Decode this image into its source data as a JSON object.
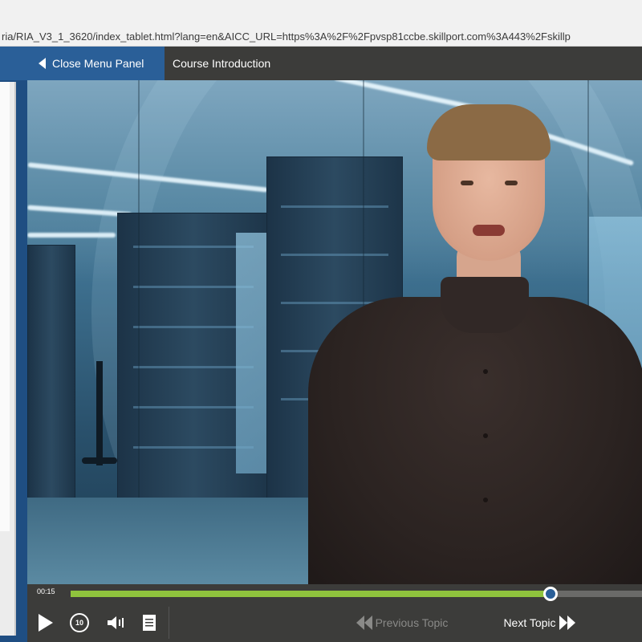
{
  "browser": {
    "url": "ria/RIA_V3_1_3620/index_tablet.html?lang=en&AICC_URL=https%3A%2F%2Fpvsp81ccbe.skillport.com%3A443%2Fskillp"
  },
  "header": {
    "close_menu_label": "Close Menu Panel",
    "course_title": "Course Introduction"
  },
  "player": {
    "current_time": "00:15",
    "progress": 0.84,
    "replay_label": "10",
    "previous_label": "Previous Topic",
    "next_label": "Next Topic"
  },
  "icons": {
    "close": "chevron-left-icon",
    "play": "play-icon",
    "replay": "replay-10-icon",
    "volume": "volume-icon",
    "notes": "transcript-icon",
    "previous": "double-chevron-left-icon",
    "next": "double-chevron-right-icon"
  },
  "colors": {
    "accent_blue": "#2a5f98",
    "progress_green": "#8fc33d",
    "bar_bg": "#3c3c3a"
  }
}
